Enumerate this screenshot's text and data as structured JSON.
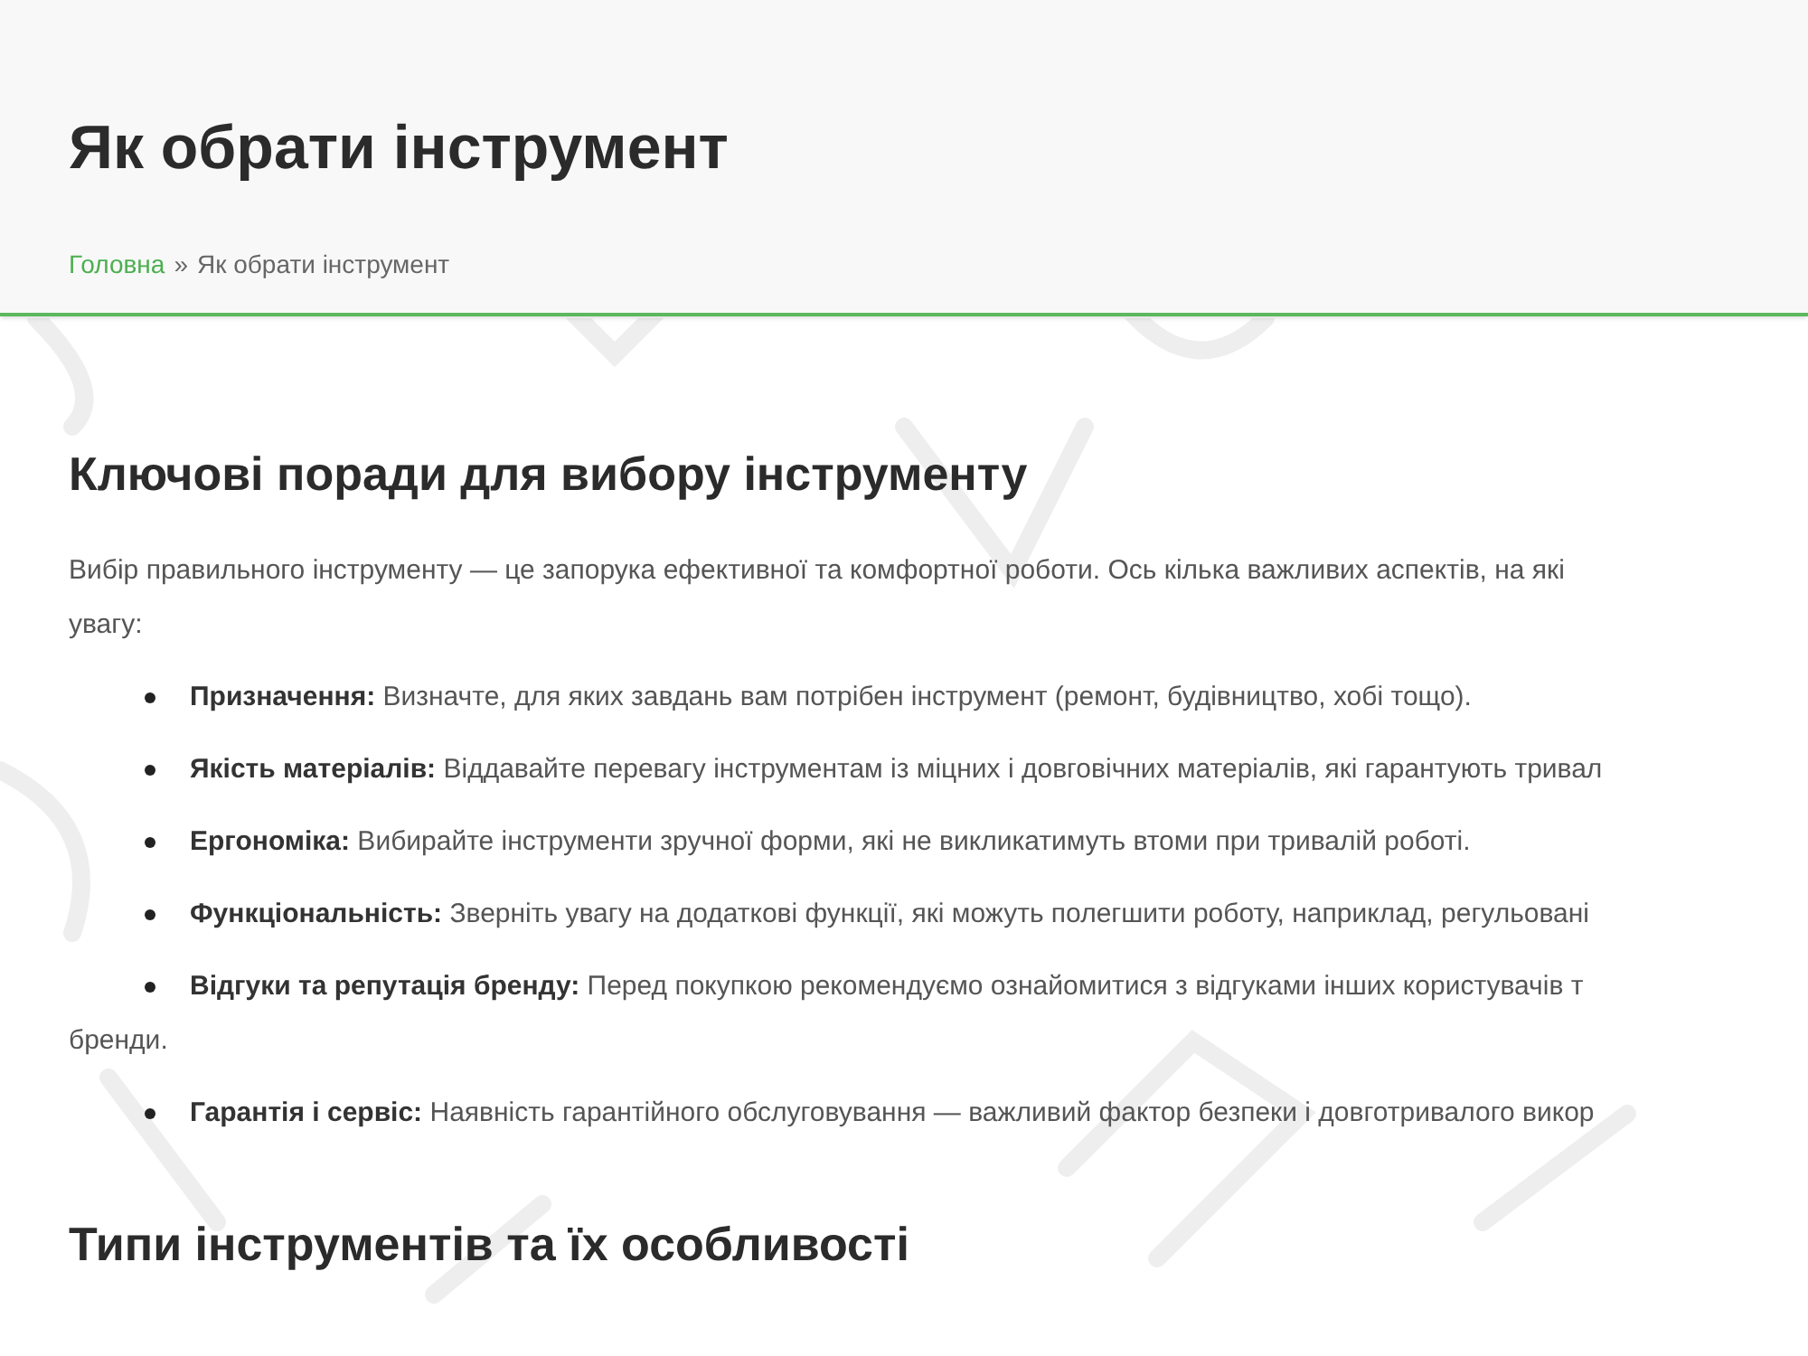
{
  "header": {
    "title": "Як обрати інструмент",
    "breadcrumb": [
      {
        "label": "Головна",
        "kind": "link"
      },
      {
        "label": "»",
        "kind": "separator"
      },
      {
        "label": "Як обрати інструмент",
        "kind": "current"
      }
    ]
  },
  "sections": [
    {
      "heading": "Ключові поради для вибору інструменту",
      "intro": [
        "Вибір правильного інструменту — це запорука ефективної та комфортної роботи. Ось кілька важливих аспектів, на які",
        "увагу:"
      ],
      "bullets": [
        {
          "lines": [
            "**Призначення:** Визначте, для яких завдань вам потрібен інструмент (ремонт, будівництво, хобі тощо)."
          ]
        },
        {
          "lines": [
            "**Якість матеріалів:** Віддавайте перевагу інструментам із міцних і довговічних матеріалів, які гарантують тривал"
          ]
        },
        {
          "lines": [
            "**Ергономіка:** Вибирайте інструменти зручної форми, які не викликатимуть втоми при тривалій роботі."
          ]
        },
        {
          "lines": [
            "**Функціональність:** Зверніть увагу на додаткові функції, які можуть полегшити роботу, наприклад, регульовані"
          ]
        },
        {
          "lines": [
            "**Відгуки та репутація бренду:** Перед покупкою рекомендуємо ознайомитися з відгуками інших користувачів т",
            "бренди."
          ]
        },
        {
          "lines": [
            "**Гарантія і сервіс:** Наявність гарантійного обслуговування — важливий фактор безпеки і довготривалого викор"
          ]
        }
      ]
    },
    {
      "heading": "Типи інструментів та їх особливості"
    }
  ]
}
